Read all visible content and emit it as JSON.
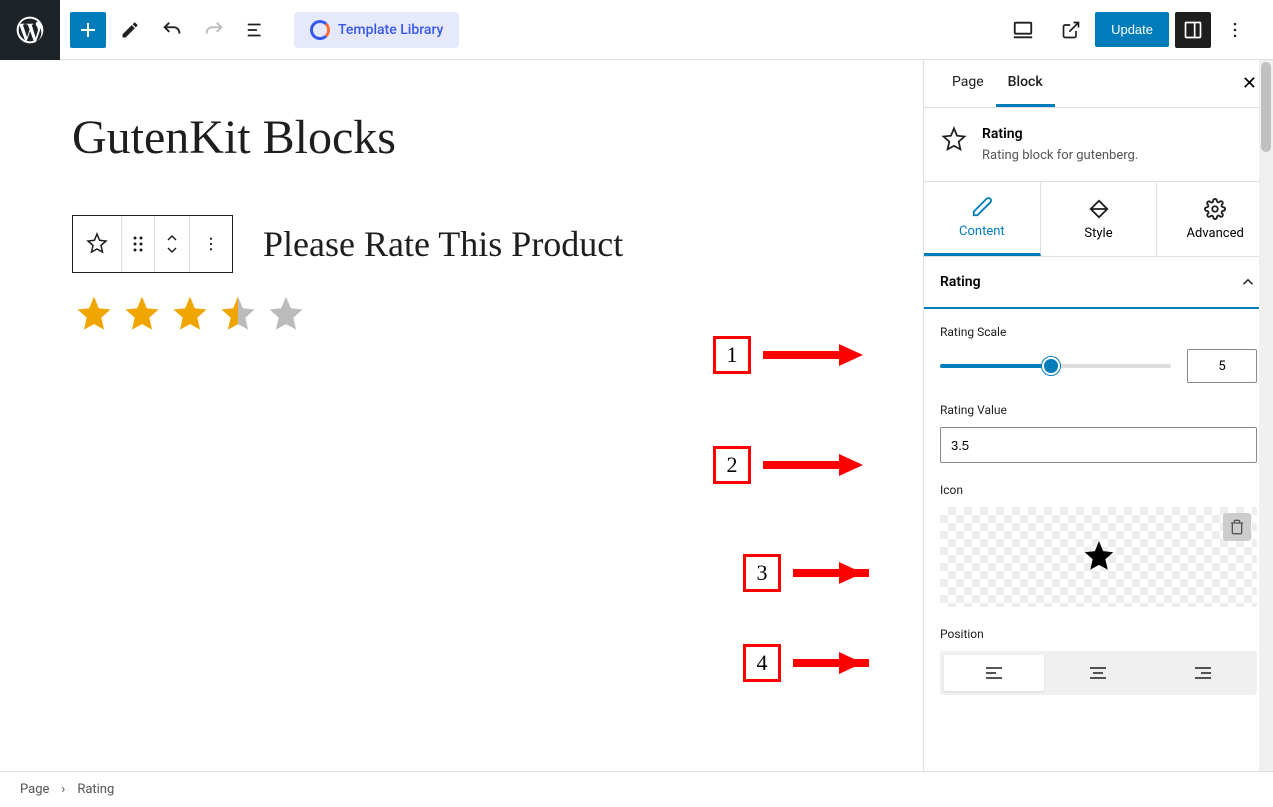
{
  "topbar": {
    "template_library": "Template Library",
    "update": "Update"
  },
  "canvas": {
    "page_title": "GutenKit Blocks",
    "rate_label": "Please Rate This Product",
    "rating_value": 3.5,
    "rating_scale": 5
  },
  "sidebar": {
    "tabs": {
      "page": "Page",
      "block": "Block"
    },
    "block_info": {
      "title": "Rating",
      "desc": "Rating block for gutenberg."
    },
    "sub_tabs": {
      "content": "Content",
      "style": "Style",
      "advanced": "Advanced"
    },
    "panel": {
      "title": "Rating",
      "rating_scale_label": "Rating Scale",
      "rating_scale_value": "5",
      "rating_value_label": "Rating Value",
      "rating_value": "3.5",
      "icon_label": "Icon",
      "position_label": "Position"
    }
  },
  "callouts": {
    "c1": "1",
    "c2": "2",
    "c3": "3",
    "c4": "4"
  },
  "breadcrumb": {
    "page": "Page",
    "block": "Rating"
  }
}
